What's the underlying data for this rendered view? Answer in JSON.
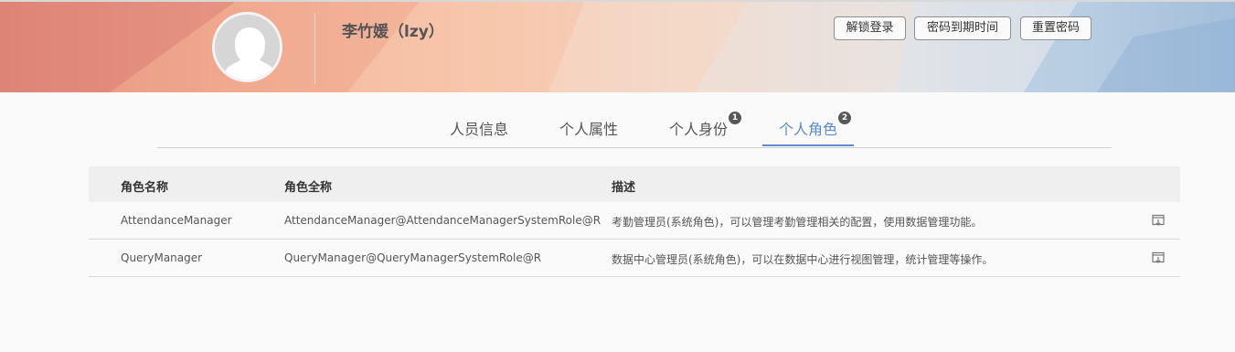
{
  "user": {
    "name": "李竹媛（lzy）"
  },
  "header_buttons": {
    "unlock": "解锁登录",
    "password_expiry": "密码到期时间",
    "reset_password": "重置密码"
  },
  "tabs": [
    {
      "label": "人员信息",
      "badge": "",
      "active": false
    },
    {
      "label": "个人属性",
      "badge": "",
      "active": false
    },
    {
      "label": "个人身份",
      "badge": "1",
      "active": false
    },
    {
      "label": "个人角色",
      "badge": "2",
      "active": true
    }
  ],
  "table": {
    "columns": [
      "角色名称",
      "角色全称",
      "描述"
    ],
    "rows": [
      {
        "name": "AttendanceManager",
        "full_name": "AttendanceManager@AttendanceManagerSystemRole@R",
        "description": "考勤管理员(系统角色)，可以管理考勤管理相关的配置，使用数据管理功能。",
        "action_icon": "export-icon"
      },
      {
        "name": "QueryManager",
        "full_name": "QueryManager@QueryManagerSystemRole@R",
        "description": "数据中心管理员(系统角色)，可以在数据中心进行视图管理，统计管理等操作。",
        "action_icon": "export-icon"
      }
    ]
  },
  "colors": {
    "accent": "#5b8bc9",
    "badge": "#595959"
  }
}
